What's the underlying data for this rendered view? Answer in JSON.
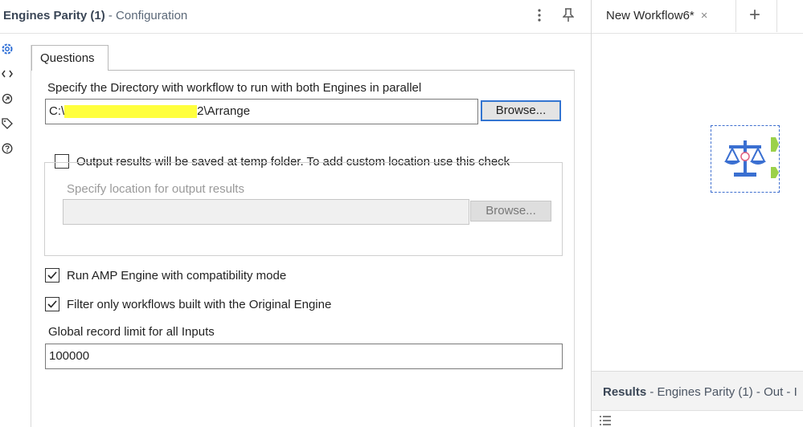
{
  "config_panel": {
    "tool_name": "Engines Parity (1)",
    "title_separator": "-",
    "title_suffix": "Configuration",
    "icons": [
      "more-vert-icon",
      "pin-icon"
    ],
    "sidebar_icons": [
      "gear-icon",
      "code-icon",
      "annotation-icon",
      "tag-icon",
      "help-icon"
    ]
  },
  "questions_tab": {
    "label": "Questions"
  },
  "directory": {
    "label": "Specify the Directory with workflow to run with both Engines in parallel",
    "value_prefix": "C:\\",
    "value_redacted_hint": "",
    "value_suffix": "2\\Arrange",
    "browse_label": "Browse..."
  },
  "output": {
    "checkbox_checked": false,
    "checkbox_label": "Output results will be saved at temp folder. To add custom location use this check",
    "location_label": "Specify location for output results",
    "location_value": "",
    "browse_label": "Browse..."
  },
  "amp": {
    "checkbox_checked": true,
    "label": "Run AMP Engine with compatibility mode"
  },
  "filter": {
    "checkbox_checked": true,
    "label": "Filter only workflows built with the Original Engine"
  },
  "record_limit": {
    "label": "Global record limit for all Inputs",
    "value": "100000"
  },
  "canvas": {
    "tab_label": "New Workflow6*",
    "tab_close": "×",
    "add_tab": "+",
    "node_icon": "scale-balance-icon"
  },
  "results": {
    "title": "Results",
    "separator": "-",
    "detail": "Engines Parity (1) - Out - I"
  },
  "colors": {
    "accent_blue": "#3f6fcf",
    "anchor_green": "#9bd14a",
    "redaction_yellow": "#ffff3d"
  }
}
